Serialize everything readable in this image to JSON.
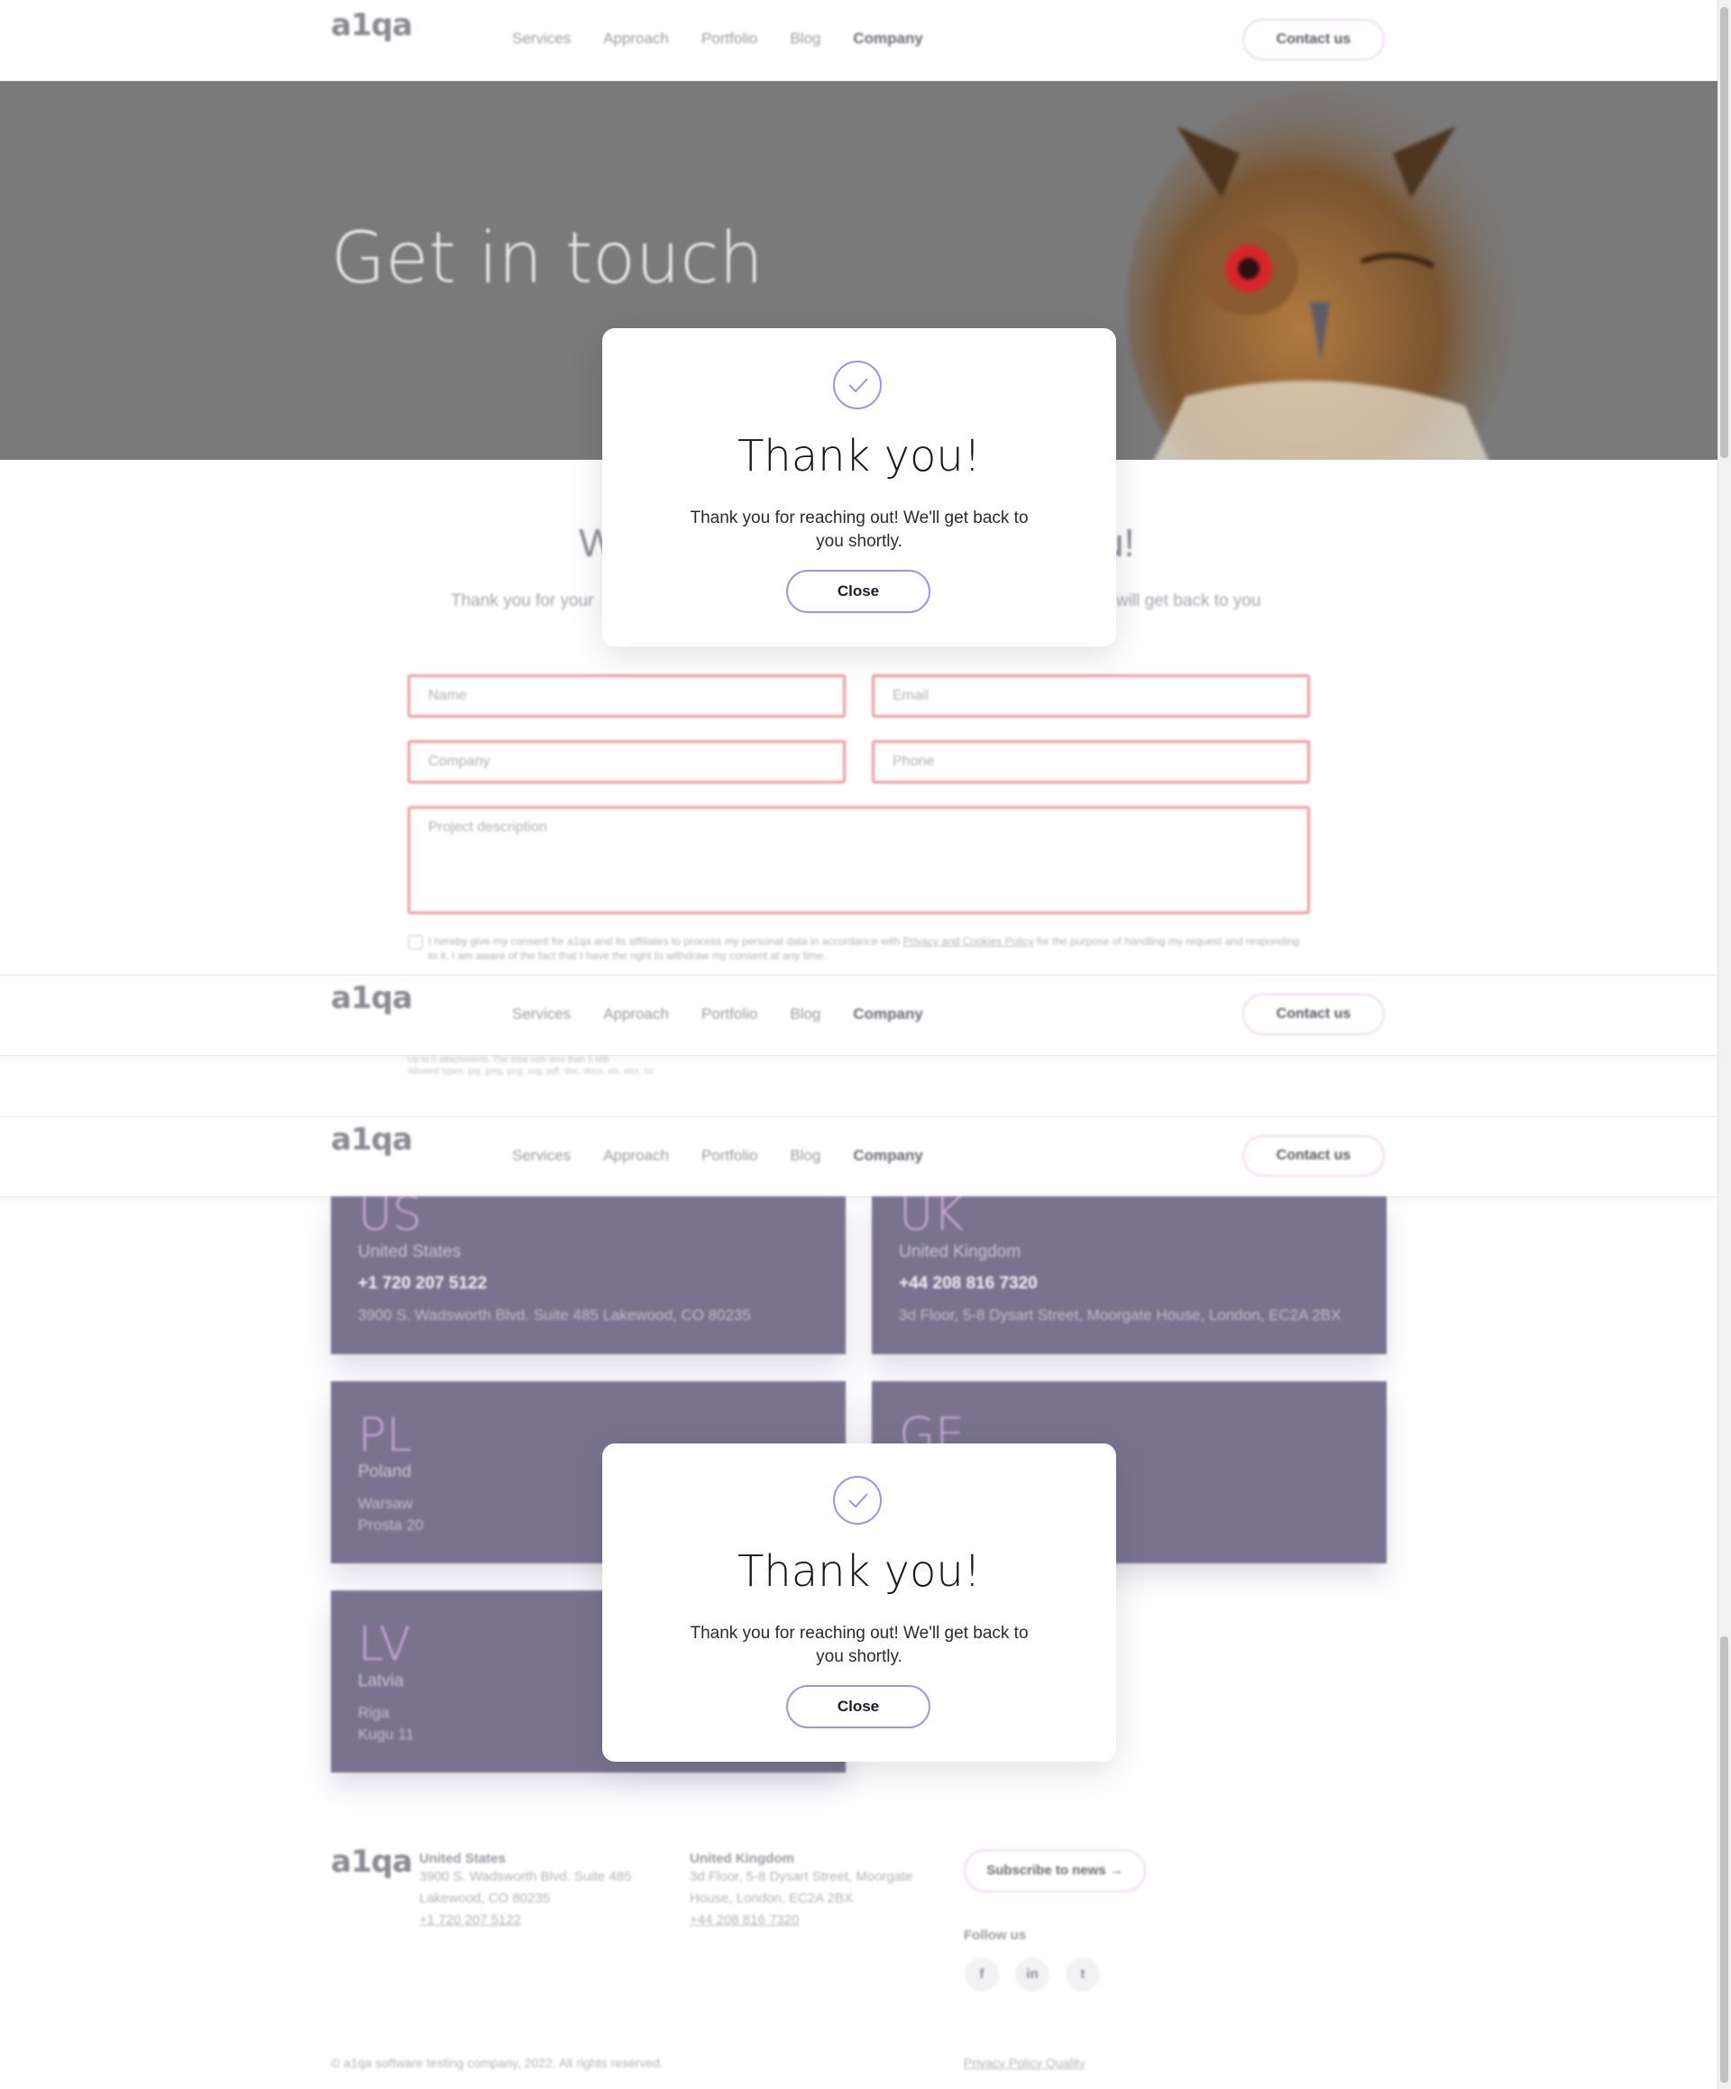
{
  "header": {
    "logo": "a1qa",
    "nav": [
      "Services",
      "Approach",
      "Portfolio",
      "Blog",
      "Company"
    ],
    "active_nav": "Company",
    "contact_button": "Contact us"
  },
  "hero": {
    "title": "Get in touch"
  },
  "form_section": {
    "heading_start": "W",
    "heading_end": "u!",
    "subtext_start": "Thank you for your",
    "subtext_end": "will get back to you",
    "name_placeholder": "Name",
    "email_placeholder": "Email",
    "company_placeholder": "Company",
    "phone_placeholder": "Phone",
    "description_placeholder": "Project description",
    "consent_text_before": "I hereby give my consent for a1qa and its affiliates to process my personal data in accordance with ",
    "consent_link": "Privacy and Cookies Policy",
    "consent_text_after": " for the purpose of handling my request and responding to it. I am aware of the fact that I have the right to withdraw my consent at any time.",
    "attachments_line1": "Up to 5 attachments. The total size less than 5 MB",
    "attachments_line2": "Allowed types: jpg, jpeg, png, svg, pdf, doc, docx, xls, xlsx, txt"
  },
  "offices": [
    {
      "code": "US",
      "country": "United States",
      "phone": "+1 720 207 5122",
      "address": "3900 S. Wadsworth Blvd. Suite 485 Lakewood, CO 80235"
    },
    {
      "code": "UK",
      "country": "United Kingdom",
      "phone": "+44 208 816 7320",
      "address": "3d Floor, 5-8 Dysart Street, Moorgate House, London, EC2A 2BX"
    },
    {
      "code": "PL",
      "country": "Poland",
      "city": "Warsaw",
      "street": "Prosta 20"
    },
    {
      "code": "GE",
      "country": "",
      "city": "",
      "street": ""
    },
    {
      "code": "LV",
      "country": "Latvia",
      "city": "Riga",
      "street": "Kugu 11"
    }
  ],
  "modal": {
    "title": "Thank you!",
    "message": "Thank you for reaching out! We'll get back to you shortly.",
    "close_button": "Close"
  },
  "footer": {
    "us_heading": "United States",
    "us_address_1": "3900 S. Wadsworth Blvd. Suite 485",
    "us_address_2": "Lakewood, CO 80235",
    "us_phone": "+1 720 207 5122",
    "uk_heading": "United Kingdom",
    "uk_address_1": "3d Floor, 5-8 Dysart Street, Moorgate",
    "uk_address_2": "House, London, EC2A 2BX",
    "uk_phone": "+44 208 816 7320",
    "subscribe_button": "Subscribe to news",
    "follow_label": "Follow us",
    "social": [
      "f",
      "in",
      "t"
    ],
    "copyright": "© a1qa software testing company, 2022. All rights reserved.",
    "policy_link": "Privacy Policy Quality"
  },
  "colors": {
    "accent": "#a493e0",
    "card_bg": "#7a738f",
    "error_border": "#f19aa0",
    "hero_bg": "#7a7a7a"
  }
}
